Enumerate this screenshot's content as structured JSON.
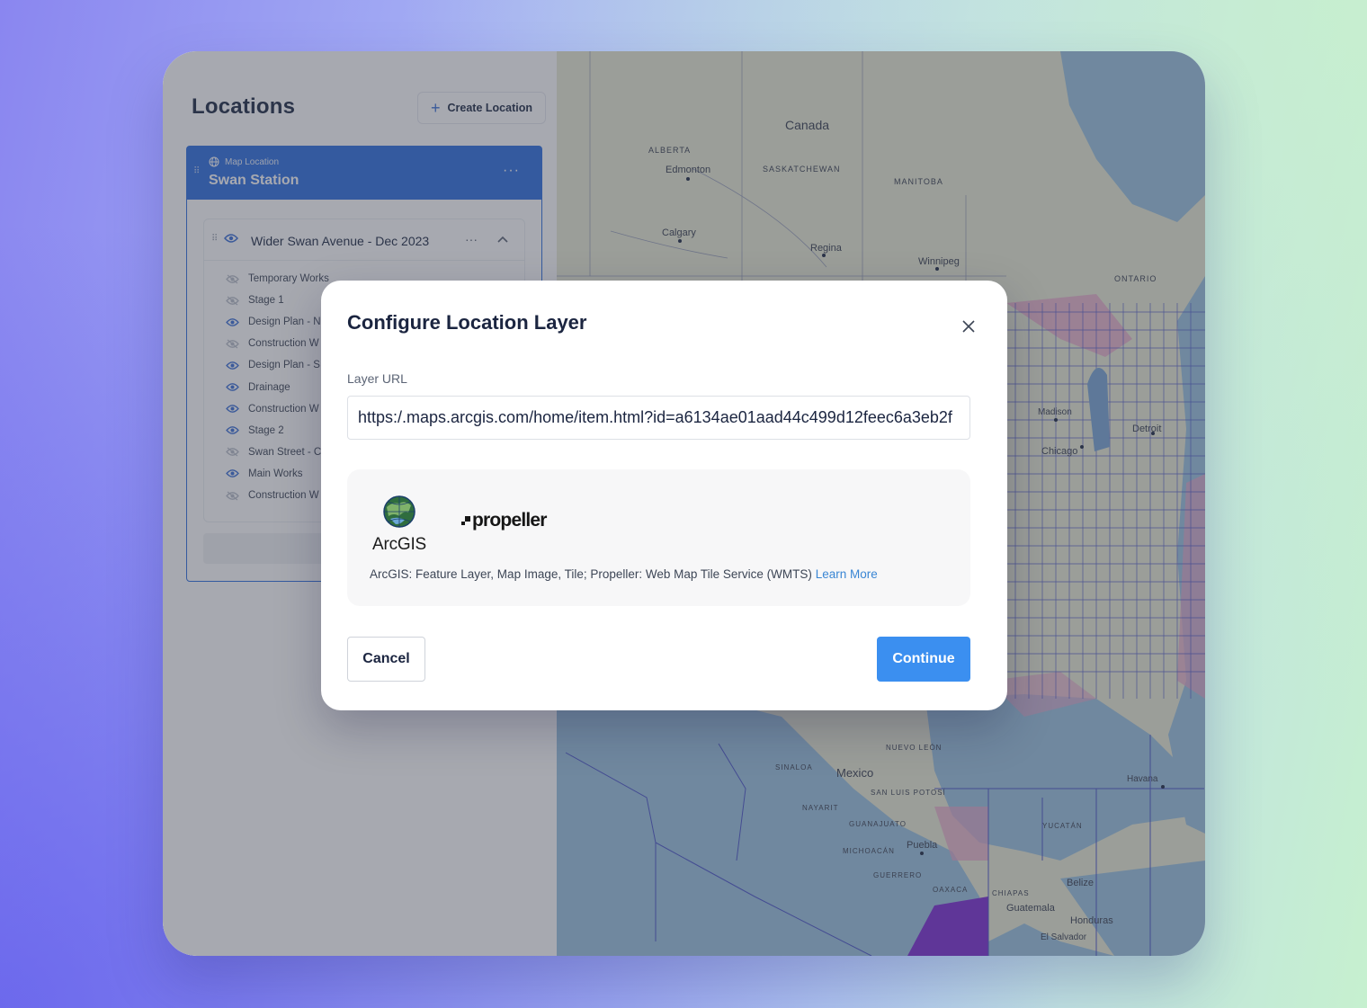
{
  "panel": {
    "title": "Locations",
    "create_label": "Create Location",
    "location": {
      "type_label": "Map Location",
      "name": "Swan Station"
    },
    "group": {
      "title": "Wider Swan Avenue - Dec 2023",
      "layers": [
        {
          "label": "Temporary Works",
          "visible": false
        },
        {
          "label": "Stage 1",
          "visible": false
        },
        {
          "label": "Design Plan - N",
          "visible": true
        },
        {
          "label": "Construction W",
          "visible": false
        },
        {
          "label": "Design Plan - S",
          "visible": true
        },
        {
          "label": "Drainage",
          "visible": true
        },
        {
          "label": "Construction W",
          "visible": true
        },
        {
          "label": "Stage 2",
          "visible": true
        },
        {
          "label": "Swan Street - C",
          "visible": false
        },
        {
          "label": "Main Works",
          "visible": true
        },
        {
          "label": "Construction W",
          "visible": false
        }
      ]
    }
  },
  "map": {
    "labels": {
      "canada": "Canada",
      "alberta": "ALBERTA",
      "saskatchewan": "SASKATCHEWAN",
      "manitoba": "MANITOBA",
      "ontario": "ONTARIO",
      "edmonton": "Edmonton",
      "calgary": "Calgary",
      "regina": "Regina",
      "winnipeg": "Winnipeg",
      "mexico": "Mexico",
      "puebla": "Puebla",
      "belize": "Belize",
      "guatemala": "Guatemala",
      "honduras": "Honduras",
      "el_salvador": "El Salvador",
      "havana": "Havana",
      "nuevo_leon": "NUEVO LEÓN",
      "san_luis": "SAN LUIS POTOSÍ",
      "michoacan": "MICHOACÁN",
      "guerrero": "GUERRERO",
      "oaxaca": "OAXACA",
      "chiapas": "CHIAPAS",
      "yucatan": "YUCATÁN",
      "guanajuato": "GUANAJUATO",
      "nayarit": "NAYARIT",
      "sinaloa": "SINALOA",
      "chicago": "Chicago",
      "detroit": "Detroit",
      "madison": "Madison"
    },
    "colors": {
      "water": "#9cc4e0",
      "land": "#e9ecd6",
      "borders": "#4b56c9",
      "highlight": "#e9a6c9"
    }
  },
  "modal": {
    "title": "Configure Location Layer",
    "field_label": "Layer URL",
    "url_value": "https:/.maps.arcgis.com/home/item.html?id=a6134ae01aad44c499d12feec6a3eb2f",
    "arcgis_label": "ArcGIS",
    "propeller_label": "propeller",
    "description": "ArcGIS: Feature Layer, Map Image, Tile; Propeller: Web Map Tile Service (WMTS)",
    "learn_more": "Learn More",
    "cancel_label": "Cancel",
    "continue_label": "Continue"
  },
  "colors": {
    "accent": "#2f6fe0",
    "primary_button": "#3b8ff0",
    "link": "#3a86d4"
  }
}
